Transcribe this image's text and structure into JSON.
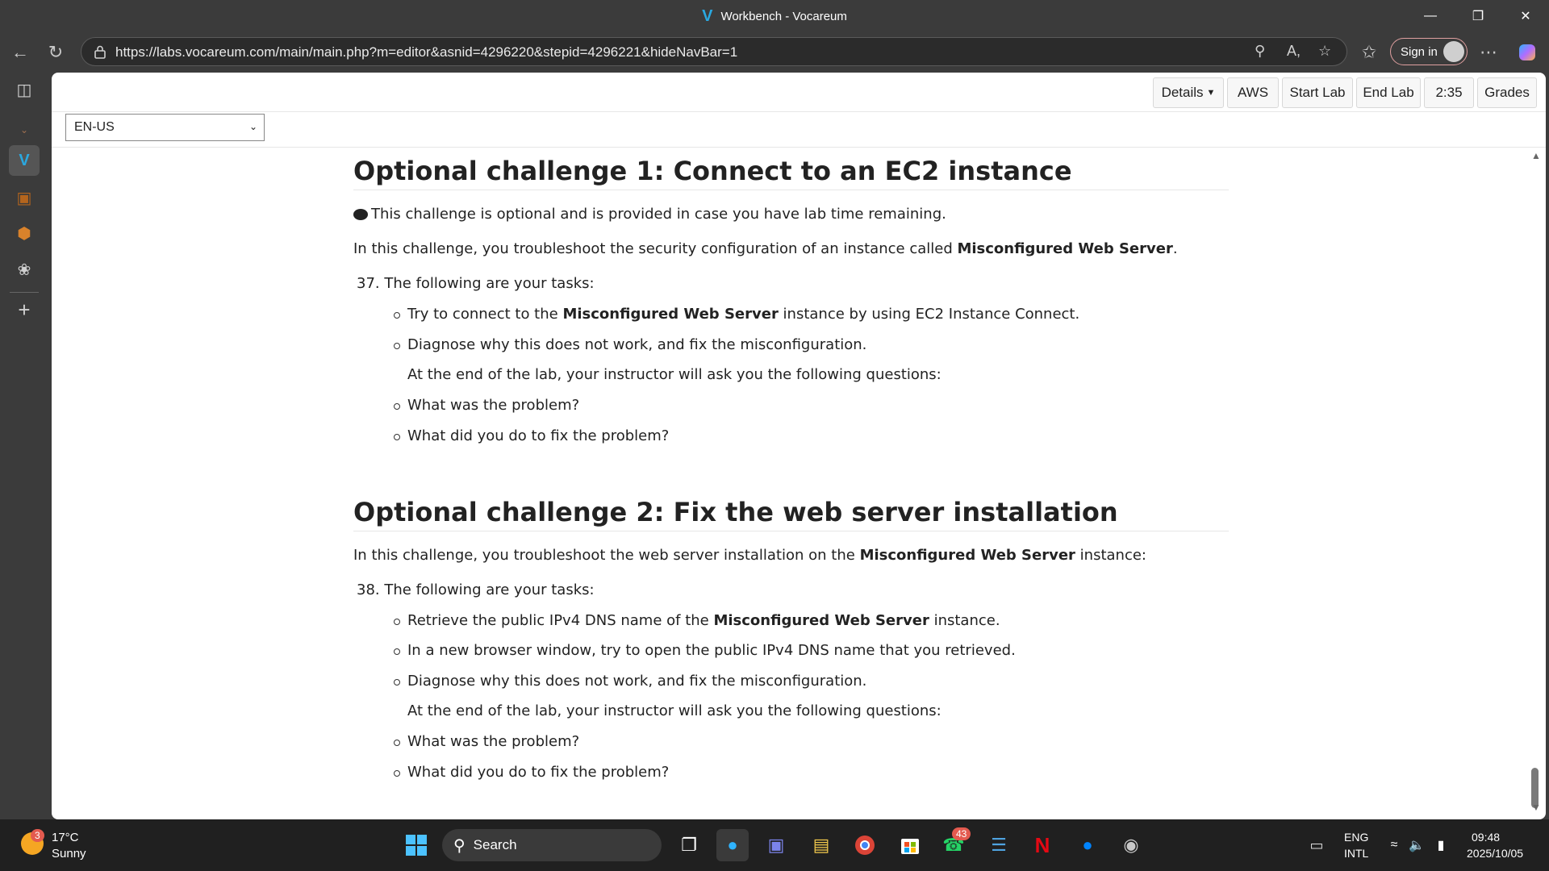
{
  "window": {
    "title": "Workbench - Vocareum"
  },
  "browser": {
    "url": "https://labs.vocareum.com/main/main.php?m=editor&asnid=4296220&stepid=4296221&hideNavBar=1",
    "sign_in": "Sign in"
  },
  "toolbar": {
    "details": "Details",
    "aws": "AWS",
    "start_lab": "Start Lab",
    "end_lab": "End Lab",
    "timer": "2:35",
    "grades": "Grades"
  },
  "language": {
    "selected": "EN-US"
  },
  "doc": {
    "c1": {
      "heading": "Optional challenge 1: Connect to an EC2 instance",
      "note": "This challenge is optional and is provided in case you have lab time remaining.",
      "intro_pre": "In this challenge, you troubleshoot the security configuration of an instance called ",
      "intro_bold": "Misconfigured Web Server",
      "intro_post": ".",
      "task_num": "37.",
      "task_label": "The following are your tasks:",
      "b1_pre": "Try to connect to the ",
      "b1_bold": "Misconfigured Web Server",
      "b1_post": " instance by using EC2 Instance Connect.",
      "b2": "Diagnose why this does not work, and fix the misconfiguration.",
      "q_intro": "At the end of the lab, your instructor will ask you the following questions:",
      "q1": "What was the problem?",
      "q2": "What did you do to fix the problem?"
    },
    "c2": {
      "heading": "Optional challenge 2: Fix the web server installation",
      "intro_pre": "In this challenge, you troubleshoot the web server installation on the ",
      "intro_bold": "Misconfigured Web Server",
      "intro_post": " instance:",
      "task_num": "38.",
      "task_label": "The following are your tasks:",
      "b1_pre": "Retrieve the public IPv4 DNS name of the ",
      "b1_bold": "Misconfigured Web Server",
      "b1_post": " instance.",
      "b2": "In a new browser window, try to open the public IPv4 DNS name that you retrieved.",
      "b3": "Diagnose why this does not work, and fix the misconfiguration.",
      "q_intro": "At the end of the lab, your instructor will ask you the following questions:",
      "q1": "What was the problem?",
      "q2": "What did you do to fix the problem?"
    }
  },
  "taskbar": {
    "weather_temp": "17°C",
    "weather_desc": "Sunny",
    "weather_badge": "3",
    "search": "Search",
    "whatsapp_badge": "43",
    "lang_top": "ENG",
    "lang_bottom": "INTL",
    "time": "09:48",
    "date": "2025/10/05"
  }
}
